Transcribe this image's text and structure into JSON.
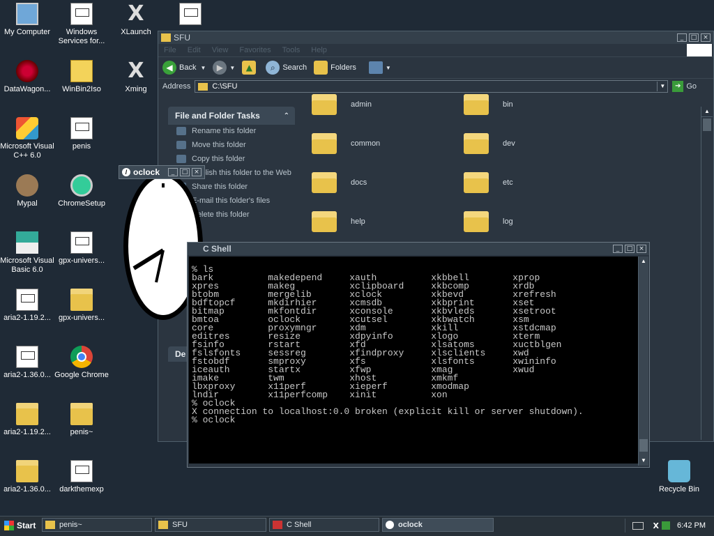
{
  "desktop_icons": [
    {
      "label": "My Computer",
      "icon": "computer-icon"
    },
    {
      "label": "Windows Services for...",
      "icon": "document-icon"
    },
    {
      "label": "XLaunch",
      "icon": "x-logo-icon"
    },
    {
      "label": "DataWagon...",
      "icon": "web-icon"
    },
    {
      "label": "WinBin2Iso",
      "icon": "zip-icon"
    },
    {
      "label": "Xming",
      "icon": "x-logo-icon"
    },
    {
      "label": "Microsoft Visual C++ 6.0",
      "icon": "visual-cpp-icon"
    },
    {
      "label": "penis",
      "icon": "document-icon"
    },
    {
      "label": "Mypal",
      "icon": "mypal-icon"
    },
    {
      "label": "ChromeSetup",
      "icon": "setup-icon"
    },
    {
      "label": "Microsoft Visual Basic 6.0",
      "icon": "visual-basic-icon"
    },
    {
      "label": "gpx-univers...",
      "icon": "document-icon"
    },
    {
      "label": "aria2-1.19.2...",
      "icon": "document-icon"
    },
    {
      "label": "gpx-univers...",
      "icon": "folder-icon"
    },
    {
      "label": "aria2-1.36.0...",
      "icon": "document-icon"
    },
    {
      "label": "Google Chrome",
      "icon": "chrome-icon"
    },
    {
      "label": "aria2-1.19.2...",
      "icon": "folder-icon"
    },
    {
      "label": "penis~",
      "icon": "folder-icon"
    },
    {
      "label": "aria2-1.36.0...",
      "icon": "folder-icon"
    },
    {
      "label": "darkthemexp",
      "icon": "image-icon"
    },
    {
      "label": "Recycle Bin",
      "icon": "recycle-bin-icon"
    }
  ],
  "explorer": {
    "title": "SFU",
    "menu": [
      "File",
      "Edit",
      "View",
      "Favorites",
      "Tools",
      "Help"
    ],
    "toolbar": {
      "back": "Back",
      "search": "Search",
      "folders": "Folders"
    },
    "address_label": "Address",
    "address_value": "C:\\SFU",
    "go_label": "Go",
    "tasks_title": "File and Folder Tasks",
    "tasks": [
      "Rename this folder",
      "Move this folder",
      "Copy this folder",
      "Publish this folder to the Web",
      "Share this folder",
      "E-mail this folder's files",
      "Delete this folder"
    ],
    "details_label": "De",
    "folders": [
      "admin",
      "bin",
      "common",
      "dev",
      "docs",
      "etc",
      "help",
      "log"
    ]
  },
  "oclock": {
    "title": "oclock"
  },
  "shell": {
    "title": "C Shell",
    "lines": [
      "% ls",
      "bdftopcf      mkdirhier      xcmsdb         xkbprint       xset",
      "bitmap        mkfontdir      xconsole       xkbvleds       xsetroot",
      "bmtoa         oclock         xcutsel        xkbwatch       xsm",
      "core          proxymngr      xdm            xkill          xstdcmap",
      "editres       resize         xdpyinfo       xlogo          xterm",
      "fsinfo        rstart         xfd            xlsatoms       xuctblgen",
      "fslsfonts     sessreg        xfindproxy     xlsclients     xwd",
      "fstobdf       smproxy        xfs            xlsfonts       xwininfo",
      "iceauth       startx         xfwp           xmag           xwud",
      "imake         twm            xhost          xmkmf",
      "lbxproxy      x11perf        xieperf        xmodmap",
      "lndir         x11perfcomp    xinit          xon",
      "% oclock",
      "X connection to localhost:0.0 broken (explicit kill or server shutdown).",
      "% oclock"
    ],
    "top_lines": [
      "bark          makedepend     xauth          xkbbell        xprop",
      "xpres         makeg          xclipboard     xkbcomp        xrdb",
      "btobm         mergelib       xclock         xkbevd         xrefresh"
    ]
  },
  "taskbar": {
    "start_label": "Start",
    "buttons": [
      {
        "label": "penis~",
        "icon": "folder-icon"
      },
      {
        "label": "SFU",
        "icon": "folder-icon"
      },
      {
        "label": "C Shell",
        "icon": "shell-icon"
      },
      {
        "label": "oclock",
        "icon": "x-logo-icon"
      }
    ],
    "clock": "6:42 PM"
  }
}
